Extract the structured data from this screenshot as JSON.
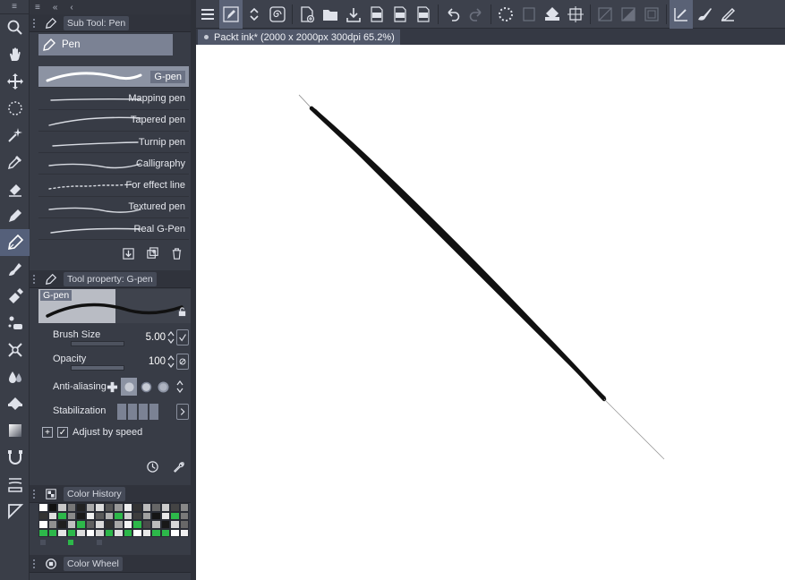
{
  "toolstrip": {
    "tools": [
      {
        "name": "zoom-icon"
      },
      {
        "name": "hand-icon"
      },
      {
        "name": "move-icon"
      },
      {
        "name": "selection-icon"
      },
      {
        "name": "auto-select-icon"
      },
      {
        "name": "eyedropper-icon"
      },
      {
        "name": "eraser-icon"
      },
      {
        "name": "pencil-icon"
      },
      {
        "name": "pen-icon",
        "selected": true
      },
      {
        "name": "brush-icon"
      },
      {
        "name": "airbrush-icon"
      },
      {
        "name": "decoration-icon"
      },
      {
        "name": "blend-icon"
      },
      {
        "name": "water-drop-icon"
      },
      {
        "name": "fill-icon"
      },
      {
        "name": "gradient-icon"
      },
      {
        "name": "figure-icon"
      },
      {
        "name": "frame-border-icon"
      },
      {
        "name": "ruler-icon"
      }
    ]
  },
  "subtool": {
    "header": "Sub Tool: Pen",
    "group_label": "Pen",
    "brushes": [
      {
        "label": "G-pen",
        "selected": true
      },
      {
        "label": "Mapping pen"
      },
      {
        "label": "Tapered pen"
      },
      {
        "label": "Turnip pen"
      },
      {
        "label": "Calligraphy"
      },
      {
        "label": "For effect line"
      },
      {
        "label": "Textured pen"
      },
      {
        "label": "Real G-Pen"
      }
    ]
  },
  "toolprop": {
    "header": "Tool property: G-pen",
    "preview_label": "G-pen",
    "brush_size": {
      "label": "Brush Size",
      "value": "5.00"
    },
    "opacity": {
      "label": "Opacity",
      "value": "100"
    },
    "antialiasing": {
      "label": "Anti-aliasing"
    },
    "stabilization": {
      "label": "Stabilization"
    },
    "adjust_by_speed": {
      "label": "Adjust by speed",
      "checked": true
    }
  },
  "colorhistory": {
    "header": "Color History",
    "swatches": [
      "#ffffff",
      "#111111",
      "#c8c8c8",
      "#777777",
      "#222222",
      "#aaaaaa",
      "#dddddd",
      "#555555",
      "#999999",
      "#eeeeee",
      "#333333",
      "#bbbbbb",
      "#666666",
      "#cccccc",
      "#444444",
      "#888888",
      "#333333",
      "#e0e0e0",
      "#2db84a",
      "#8a8a8a",
      "#1a1a1a",
      "#f0f0f0",
      "#5a5a5a",
      "#b0b0b0",
      "#2db84a",
      "#d0d0d0",
      "#3d3d3d",
      "#a0a0a0",
      "#151515",
      "#e8e8e8",
      "#2db84a",
      "#7a7a7a",
      "#ffffff",
      "#909090",
      "#202020",
      "#c0c0c0",
      "#2db84a",
      "#606060",
      "#dadada",
      "#303030",
      "#a8a8a8",
      "#f5f5f5",
      "#2db84a",
      "#4a4a4a",
      "#bcbcbc",
      "#181818",
      "#d8d8d8",
      "#686868",
      "#2db84a",
      "#2db84a",
      "#e4e4e4",
      "#2db84a",
      "#dcdcdc",
      "#ffffff",
      "#d4d4d4",
      "#2db84a",
      "#e0e0e0",
      "#2db84a",
      "#ffffff",
      "#e8e8e8",
      "#2db84a",
      "#2db84a",
      "#ffffff",
      "#f0f0f0"
    ]
  },
  "colorwheel": {
    "header": "Color Wheel"
  },
  "toolbar": {
    "icons": [
      "menu-icon",
      "select-tool-icon",
      "toggle-arrows-icon",
      "spiral-icon",
      "new-icon",
      "open-icon",
      "save-icon",
      "export-jpg-icon",
      "export-png-icon",
      "export-psd-icon",
      "undo-icon",
      "redo-icon",
      "loading-icon",
      "clear-icon",
      "fill-layer-icon",
      "crop-icon",
      "deselect-icon",
      "invert-icon",
      "border-icon",
      "pen-mode-icon",
      "brush-mode-icon",
      "pencil-mode-icon"
    ]
  },
  "document": {
    "tab_title": "Packt ink* (2000 x 2000px 300dpi 65.2%)"
  },
  "colors": {
    "accent": "#5a6276",
    "ink": "#111111"
  }
}
